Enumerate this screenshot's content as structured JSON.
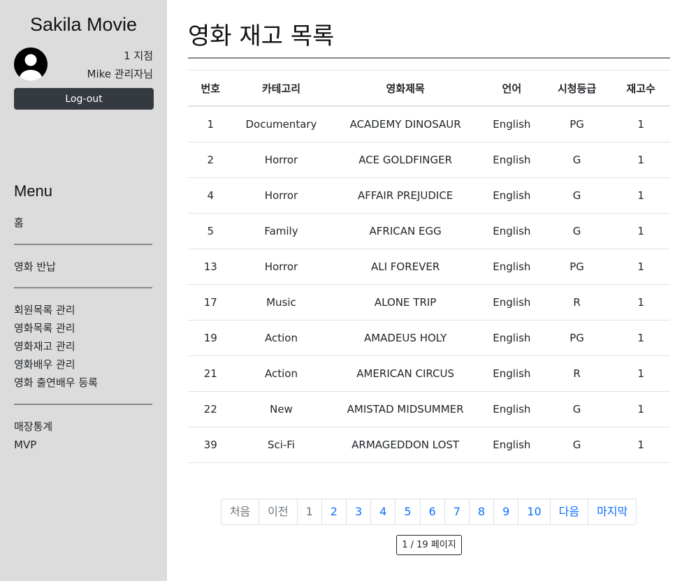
{
  "sidebar": {
    "app_title": "Sakila Movie",
    "branch": "1 지점",
    "user": "Mike 관리자님",
    "logout_label": "Log-out",
    "menu_title": "Menu",
    "menu_groups": [
      [
        "홈"
      ],
      [
        "영화 반납"
      ],
      [
        "회원목록 관리",
        "영화목록 관리",
        "영화재고 관리",
        "영화배우 관리",
        "영화 출연배우 등록"
      ],
      [
        "매장통계",
        "MVP"
      ]
    ]
  },
  "main": {
    "title": "영화 재고 목록",
    "columns": [
      "번호",
      "카테고리",
      "영화제목",
      "언어",
      "시청등급",
      "재고수"
    ],
    "rows": [
      [
        "1",
        "Documentary",
        "ACADEMY DINOSAUR",
        "English",
        "PG",
        "1"
      ],
      [
        "2",
        "Horror",
        "ACE GOLDFINGER",
        "English",
        "G",
        "1"
      ],
      [
        "4",
        "Horror",
        "AFFAIR PREJUDICE",
        "English",
        "G",
        "1"
      ],
      [
        "5",
        "Family",
        "AFRICAN EGG",
        "English",
        "G",
        "1"
      ],
      [
        "13",
        "Horror",
        "ALI FOREVER",
        "English",
        "PG",
        "1"
      ],
      [
        "17",
        "Music",
        "ALONE TRIP",
        "English",
        "R",
        "1"
      ],
      [
        "19",
        "Action",
        "AMADEUS HOLY",
        "English",
        "PG",
        "1"
      ],
      [
        "21",
        "Action",
        "AMERICAN CIRCUS",
        "English",
        "R",
        "1"
      ],
      [
        "22",
        "New",
        "AMISTAD MIDSUMMER",
        "English",
        "G",
        "1"
      ],
      [
        "39",
        "Sci-Fi",
        "ARMAGEDDON LOST",
        "English",
        "G",
        "1"
      ]
    ],
    "pagination": {
      "first": "처음",
      "prev": "이전",
      "pages": [
        "1",
        "2",
        "3",
        "4",
        "5",
        "6",
        "7",
        "8",
        "9",
        "10"
      ],
      "next": "다음",
      "last": "마지막",
      "current_page": "1"
    },
    "page_info": "1 / 19 페이지"
  }
}
